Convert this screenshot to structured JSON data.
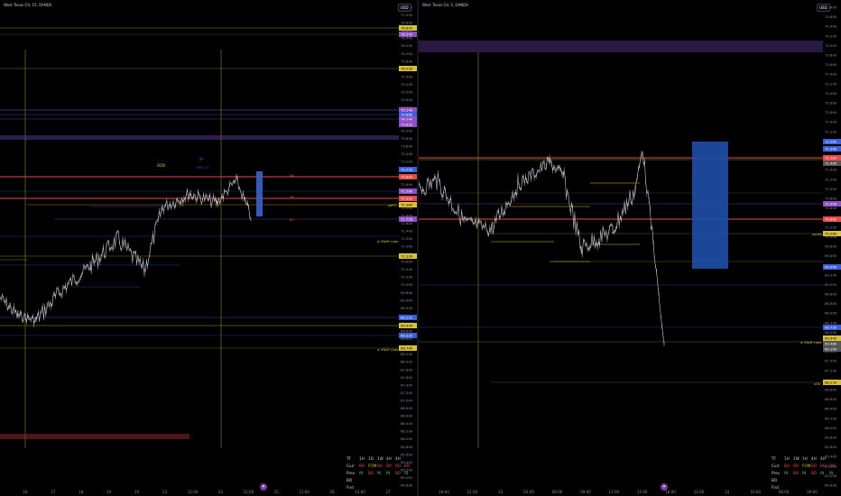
{
  "left": {
    "title": "West Texas Oil, 15, OANDA",
    "currency": "USD",
    "price_axis": {
      "labels": [
        "77.200",
        "77.000",
        "76.800",
        "76.600",
        "76.400",
        "76.200",
        "76.000",
        "75.800",
        "75.600",
        "75.400",
        "75.200",
        "75.000",
        "74.800",
        "74.600",
        "74.400",
        "74.200",
        "74.000",
        "73.800",
        "73.600",
        "73.400",
        "73.200",
        "73.000",
        "72.800",
        "72.600",
        "72.400",
        "72.200",
        "72.000",
        "71.800",
        "71.600",
        "71.400",
        "71.200",
        "71.000",
        "70.800",
        "70.600",
        "70.400",
        "70.200",
        "70.000",
        "69.800",
        "69.600",
        "69.400",
        "69.200",
        "69.000",
        "68.800",
        "68.600",
        "68.400",
        "68.200",
        "68.000",
        "67.800",
        "67.600",
        "67.400",
        "67.200",
        "67.000",
        "66.800",
        "66.600",
        "66.400",
        "66.200",
        "66.000",
        "65.800",
        "65.600",
        "65.400",
        "65.200",
        "65.000",
        "64.800"
      ],
      "highlights": [
        "76.820",
        "76.545",
        "76.020",
        "75.140",
        "74.860",
        "74.740",
        "74.620",
        "74.550",
        "72.820",
        "72.560",
        "72.420",
        "71.965",
        "71.728",
        "71.220",
        "69.520",
        "69.444",
        "69.220",
        "68.740"
      ]
    },
    "time_axis": [
      "16",
      "17",
      "18",
      "19",
      "20",
      "23",
      "12:00",
      "24",
      "12:00",
      "25",
      "12:00",
      "26",
      "12:00",
      "27"
    ],
    "annotations": {
      "ob": "OOB",
      "w": "W",
      "fvg": "FVG: 71",
      "vwap_close_1": "w VWAP close",
      "vwap_close_2": "w VWAP close",
      "dpo": "pdPO",
      "pwo": "pwVO",
      "mo": "MO",
      "mp": "MP",
      "bd": "BO"
    },
    "table": {
      "header": [
        "TF",
        "1H",
        "1D",
        "1W",
        "4H",
        "4H"
      ],
      "rows": [
        {
          "label": "Curr",
          "cells": [
            "BO",
            "FOM",
            "BO",
            "BO",
            "BO",
            "BO"
          ]
        },
        {
          "label": "Prev",
          "cells": [
            "IN",
            "BO",
            "IN",
            "IN",
            "BO",
            "IN"
          ]
        },
        {
          "label": "BO",
          "cells": []
        },
        {
          "label": "Fnd",
          "cells": []
        }
      ]
    }
  },
  "right": {
    "title": "West Texas Oil, 5, OANDA",
    "currency": "USD",
    "price_axis": {
      "labels": [
        "74.800",
        "74.600",
        "74.400",
        "74.200",
        "74.000",
        "73.800",
        "73.600",
        "73.400",
        "73.200",
        "73.000",
        "72.800",
        "72.600",
        "72.400",
        "72.200",
        "72.000",
        "71.800",
        "71.600",
        "71.400",
        "71.200",
        "71.000",
        "70.800",
        "70.600",
        "70.400",
        "70.200",
        "70.000",
        "69.800",
        "69.600",
        "69.400",
        "69.200",
        "69.000",
        "68.800",
        "68.600",
        "68.400",
        "68.200",
        "68.000",
        "67.800",
        "67.600",
        "67.400",
        "67.200",
        "67.000",
        "66.800",
        "66.600",
        "66.400",
        "66.200",
        "66.000",
        "65.800",
        "65.600",
        "65.400",
        "65.200",
        "65.000",
        "64.800"
      ],
      "highlights": [
        "72.000",
        "71.900",
        "71.787",
        "71.400",
        "71.054",
        "70.862",
        "70.260",
        "69.990",
        "69.730",
        "69.640",
        "69.480",
        "69.100",
        "68.230"
      ]
    },
    "time_axis": [
      "18:00",
      "21:00",
      "23",
      "03:00",
      "06:00",
      "09:00",
      "12:00",
      "15:00",
      "18:00",
      "21:00",
      "24",
      "03:00",
      "06:00",
      "09:00"
    ],
    "annotations": {
      "vwap_close": "w VWAP close",
      "pivot": "pavilet",
      "wok": "wOK"
    },
    "table": {
      "header": [
        "TF",
        "1H",
        "1W",
        "1H",
        "4H",
        "4H"
      ],
      "rows": [
        {
          "label": "Curr",
          "cells": [
            "BO",
            "BO",
            "FOM",
            "BO",
            "BO",
            "BO"
          ]
        },
        {
          "label": "Prev",
          "cells": [
            "IN",
            "BO",
            "IN",
            "BO",
            "IN",
            "IN"
          ]
        },
        {
          "label": "BO",
          "cells": []
        },
        {
          "label": "Fnd",
          "cells": []
        }
      ]
    }
  },
  "colors": {
    "background": "#000000",
    "grid": "#0f1116",
    "candle": "#c7c9cf",
    "yellow": "#d8c23a",
    "red": "#e84a4a",
    "purple": "#8e4fc7",
    "blue": "#3b5fd8",
    "box_blue": "#1f4ea8"
  }
}
